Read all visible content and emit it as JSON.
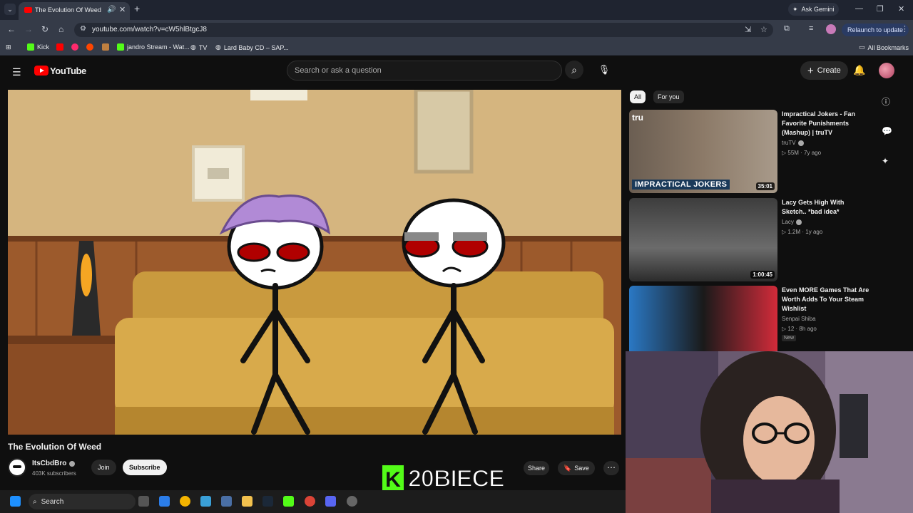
{
  "browser": {
    "tab_title": "The Evolution Of Weed - YouTube",
    "ask_gemini": "Ask Gemini",
    "url": "youtube.com/watch?v=cW5hlBtgcJ8",
    "relaunch": "Relaunch to update",
    "bookmarks": [
      "Kick",
      "jandro Stream - Wat...",
      "TV",
      "Lard Baby CD – SAP..."
    ],
    "all_bookmarks": "All Bookmarks"
  },
  "youtube": {
    "logo": "YouTube",
    "search_placeholder": "Search or ask a question",
    "create": "Create"
  },
  "video": {
    "title": "The Evolution Of Weed",
    "channel": "ItsCbdBro",
    "subscribers": "403K subscribers",
    "join": "Join",
    "subscribe": "Subscribe",
    "share": "Share",
    "save": "Save"
  },
  "chips": [
    "All",
    "For you"
  ],
  "recommendations": [
    {
      "title": "Impractical Jokers - Fan Favorite Punishments (Mashup) | truTV",
      "channel": "truTV",
      "stats": "55M · 7y ago",
      "duration": "35:01",
      "thumb_label": "IMPRACTICAL JOKERS",
      "thumb_logo": "tru",
      "verified": true
    },
    {
      "title": "Lacy Gets High With Sketch.. *bad idea*",
      "channel": "Lacy",
      "stats": "1.2M · 1y ago",
      "duration": "1:00:45",
      "verified": true
    },
    {
      "title": "Even MORE Games That Are Worth Adds To Your Steam Wishlist",
      "channel": "Senpai Shiba",
      "stats": "12 · 8h ago",
      "badge": "New"
    }
  ],
  "overlay": {
    "kick_letter": "K",
    "kick_name": "20BIECE"
  },
  "taskbar": {
    "search": "Search"
  },
  "colors": {
    "youtube_red": "#ff0000",
    "kick_green": "#53fc18",
    "background": "#0f0f0f"
  }
}
